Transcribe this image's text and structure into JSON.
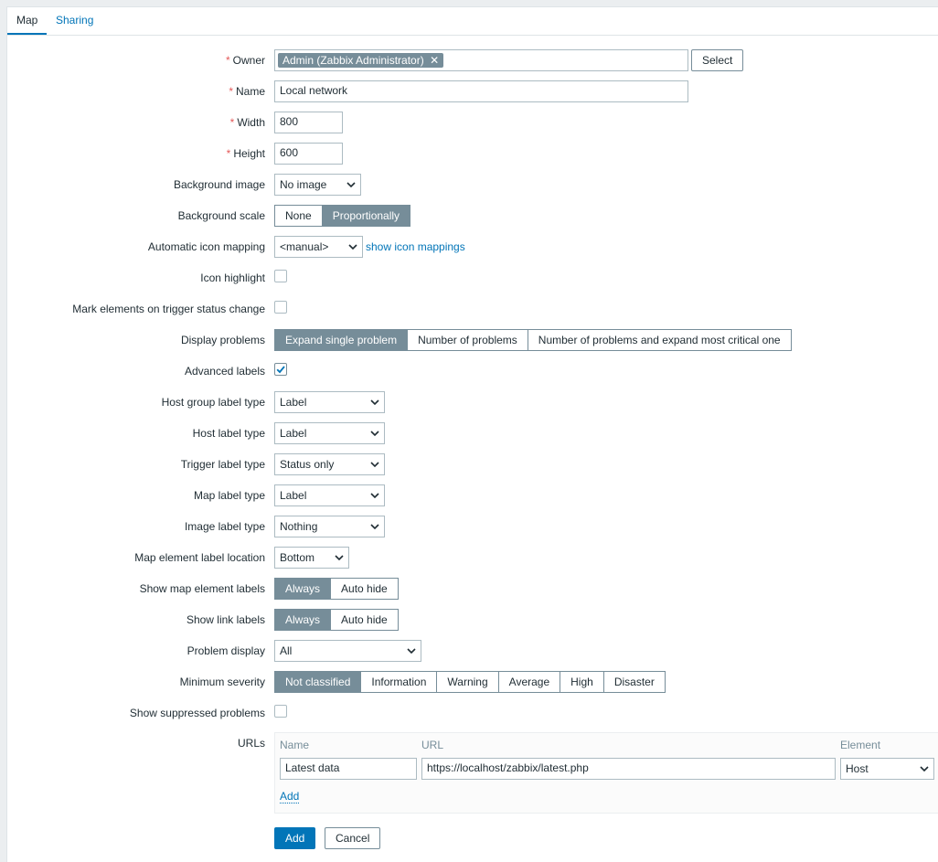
{
  "tabs": {
    "map": "Map",
    "sharing": "Sharing"
  },
  "owner": {
    "label": "Owner",
    "value": "Admin (Zabbix Administrator)",
    "select_button": "Select"
  },
  "name": {
    "label": "Name",
    "value": "Local network"
  },
  "width": {
    "label": "Width",
    "value": "800"
  },
  "height": {
    "label": "Height",
    "value": "600"
  },
  "background_image": {
    "label": "Background image",
    "value": "No image"
  },
  "background_scale": {
    "label": "Background scale",
    "options": [
      "None",
      "Proportionally"
    ],
    "selected": "Proportionally"
  },
  "icon_mapping": {
    "label": "Automatic icon mapping",
    "value": "<manual>",
    "link": "show icon mappings"
  },
  "icon_highlight": {
    "label": "Icon highlight",
    "checked": false
  },
  "mark_elements": {
    "label": "Mark elements on trigger status change",
    "checked": false
  },
  "display_problems": {
    "label": "Display problems",
    "options": [
      "Expand single problem",
      "Number of problems",
      "Number of problems and expand most critical one"
    ],
    "selected": "Expand single problem"
  },
  "advanced_labels": {
    "label": "Advanced labels",
    "checked": true
  },
  "host_group_label_type": {
    "label": "Host group label type",
    "value": "Label"
  },
  "host_label_type": {
    "label": "Host label type",
    "value": "Label"
  },
  "trigger_label_type": {
    "label": "Trigger label type",
    "value": "Status only"
  },
  "map_label_type": {
    "label": "Map label type",
    "value": "Label"
  },
  "image_label_type": {
    "label": "Image label type",
    "value": "Nothing"
  },
  "label_location": {
    "label": "Map element label location",
    "value": "Bottom"
  },
  "show_element_labels": {
    "label": "Show map element labels",
    "options": [
      "Always",
      "Auto hide"
    ],
    "selected": "Always"
  },
  "show_link_labels": {
    "label": "Show link labels",
    "options": [
      "Always",
      "Auto hide"
    ],
    "selected": "Always"
  },
  "problem_display": {
    "label": "Problem display",
    "value": "All"
  },
  "minimum_severity": {
    "label": "Minimum severity",
    "options": [
      "Not classified",
      "Information",
      "Warning",
      "Average",
      "High",
      "Disaster"
    ],
    "selected": "Not classified"
  },
  "show_suppressed": {
    "label": "Show suppressed problems",
    "checked": false
  },
  "urls": {
    "label": "URLs",
    "headers": {
      "name": "Name",
      "url": "URL",
      "element": "Element"
    },
    "rows": [
      {
        "name": "Latest data",
        "url": "https://localhost/zabbix/latest.php",
        "element": "Host"
      }
    ],
    "add_link": "Add"
  },
  "buttons": {
    "add": "Add",
    "cancel": "Cancel"
  },
  "colors": {
    "accent": "#0275b8",
    "required": "#e45959",
    "segment_on": "#768d99"
  }
}
